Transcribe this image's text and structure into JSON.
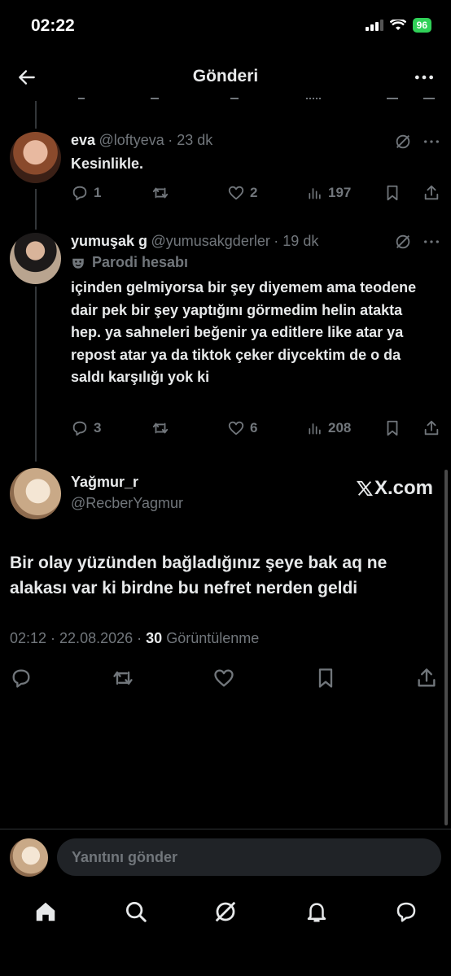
{
  "status_bar": {
    "time": "02:22",
    "battery": "96"
  },
  "header": {
    "title": "Gönderi"
  },
  "replies": [
    {
      "name": "eva",
      "handle": "@loftyeva",
      "time": "· 23 dk",
      "text": "Kesinlikle.",
      "replies_count": "1",
      "retweets": "",
      "likes": "2",
      "views": "197"
    },
    {
      "name": "yumuşak g",
      "handle": "@yumusakgderler",
      "time": "· 19 dk",
      "badge": "Parodi hesabı",
      "text": "içinden gelmiyorsa bir şey diyemem ama teodene dair pek bir şey yaptığını görmedim helin atakta hep. ya sahneleri beğenir ya editlere like atar ya repost atar ya da tiktok çeker diycektim de o da saldı karşılığı yok ki",
      "replies_count": "3",
      "retweets": "",
      "likes": "6",
      "views": "208"
    }
  ],
  "main_post": {
    "name": "Yağmur_r",
    "handle": "@RecberYagmur",
    "brand": "X.com",
    "text": "Bir olay yüzünden bağladığınız şeye bak aq ne alakası var ki birdne bu nefret nerden geldi",
    "timestamp": "02:12 · 22.08.2026 ·",
    "views_count": "30",
    "views_label": "Görüntülenme"
  },
  "composer": {
    "placeholder": "Yanıtını gönder"
  },
  "colors": {
    "background": "#000000",
    "text": "#e7e9ea",
    "muted": "#71767b",
    "battery": "#30d158"
  },
  "icons": [
    "back-icon",
    "more-icon",
    "grok-icon",
    "reply-icon",
    "retweet-icon",
    "like-icon",
    "views-icon",
    "bookmark-icon",
    "share-icon",
    "parody-mask-icon",
    "home-icon",
    "search-icon",
    "notifications-icon",
    "messages-icon"
  ]
}
